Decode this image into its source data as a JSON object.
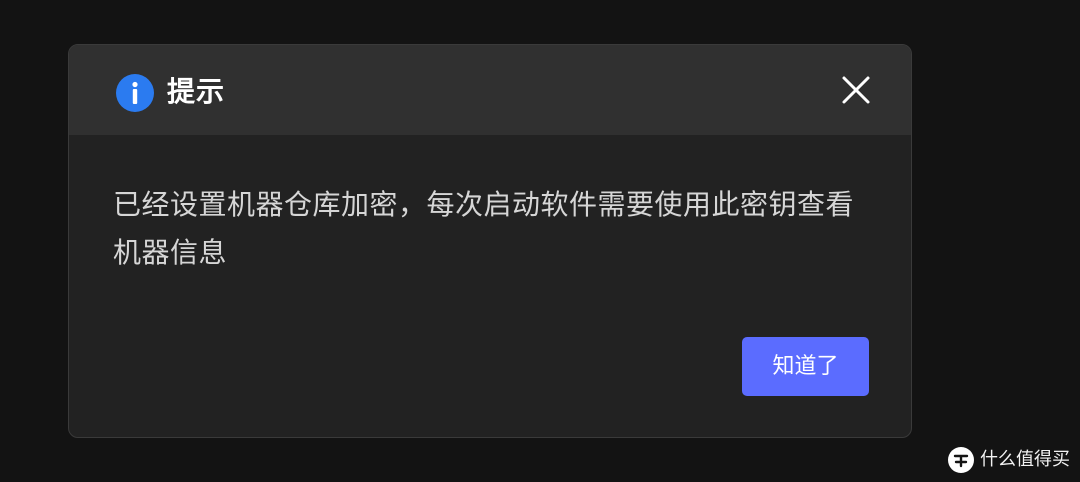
{
  "dialog": {
    "title": "提示",
    "title_icon": "info-icon",
    "close_icon": "close-icon",
    "message": "已经设置机器仓库加密，每次启动软件需要使用此密钥查看机器信息",
    "confirm_label": "知道了"
  },
  "watermark": {
    "text": "什么值得买",
    "icon": "smzdm-logo"
  },
  "colors": {
    "backdrop": "#131313",
    "dialog_body": "#222222",
    "dialog_header": "#303030",
    "info_blue": "#2b7bf0",
    "primary_button": "#5b6cff"
  }
}
